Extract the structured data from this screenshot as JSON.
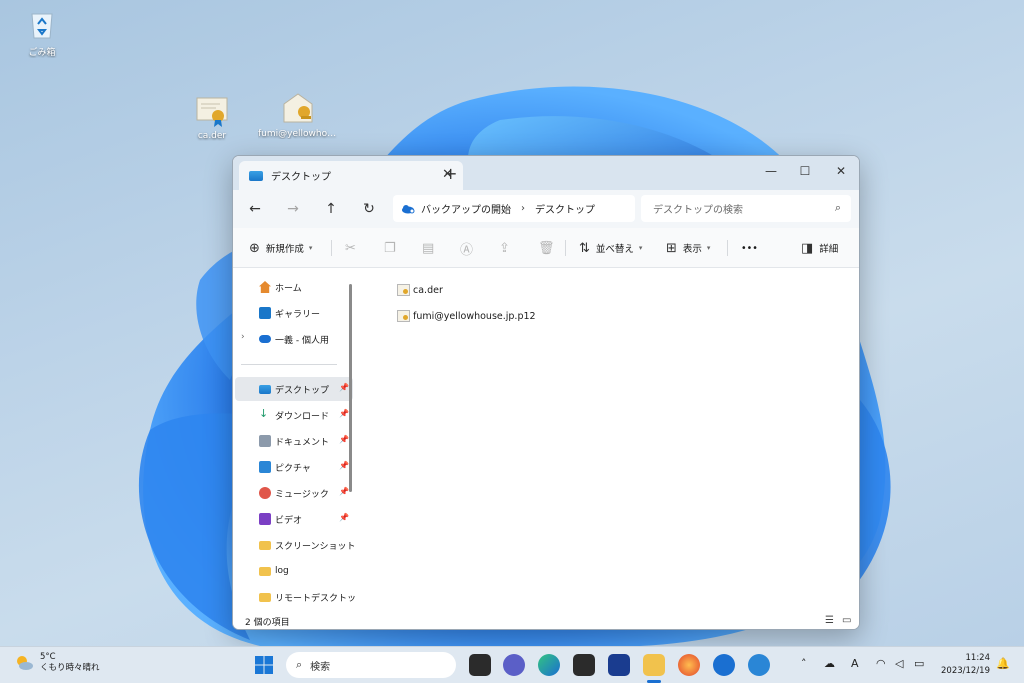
{
  "desktop": {
    "icons": [
      {
        "label": "ごみ箱"
      },
      {
        "label": "ca.der"
      },
      {
        "label": "fumi@yellowhous..."
      }
    ]
  },
  "window": {
    "tab_title": "デスクトップ",
    "close_tab": "✕",
    "new_tab": "+",
    "minimize": "—",
    "maximize": "☐",
    "close": "✕",
    "nav": {
      "back": "←",
      "forward": "→",
      "up": "↑",
      "refresh": "↻"
    },
    "address": {
      "root": "バックアップの開始",
      "separator": "›",
      "current": "デスクトップ"
    },
    "search_placeholder": "デスクトップの検索",
    "toolbar": {
      "new_label": "新規作成",
      "sort_label": "並べ替え",
      "view_label": "表示",
      "more_label": "•••",
      "details_label": "詳細"
    },
    "sidebar": {
      "items": [
        {
          "label": "ホーム"
        },
        {
          "label": "ギャラリー"
        },
        {
          "label": "一義 - 個人用"
        },
        {
          "label": "デスクトップ"
        },
        {
          "label": "ダウンロード"
        },
        {
          "label": "ドキュメント"
        },
        {
          "label": "ピクチャ"
        },
        {
          "label": "ミュージック"
        },
        {
          "label": "ビデオ"
        },
        {
          "label": "スクリーンショット"
        },
        {
          "label": "log"
        },
        {
          "label": "リモートデスクトップ"
        }
      ]
    },
    "files": [
      {
        "name": "ca.der"
      },
      {
        "name": "fumi@yellowhouse.jp.p12"
      }
    ],
    "status": "2 個の項目"
  },
  "taskbar": {
    "weather_temp": "5°C",
    "weather_desc": "くもり時々晴れ",
    "search_label": "検索",
    "time": "11:24",
    "date": "2023/12/19",
    "ime": "A"
  },
  "colors": {
    "accent": "#1a6fd1",
    "titlebar": "#d9e4ef",
    "selected": "#e5e8ec"
  }
}
